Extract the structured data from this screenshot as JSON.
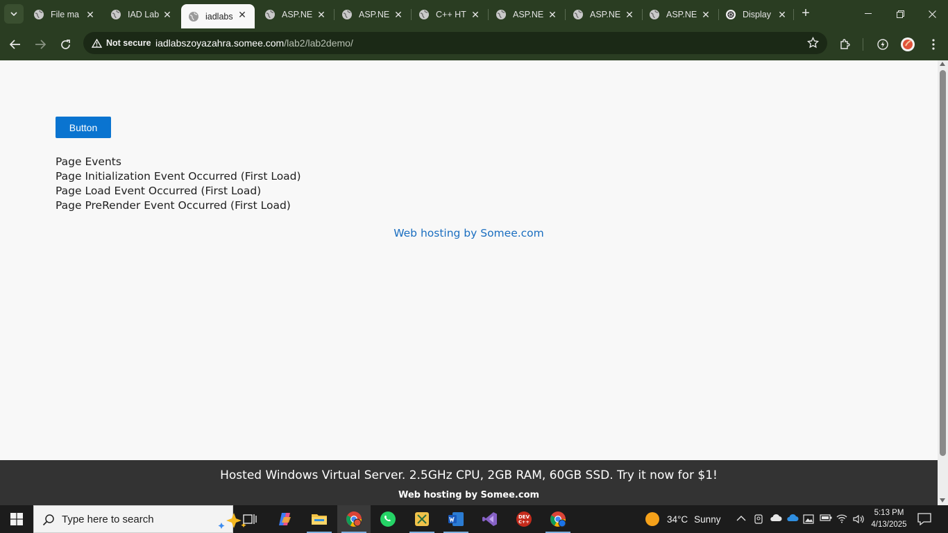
{
  "browser": {
    "tabs": [
      {
        "title": "File ma",
        "active": false,
        "icon": "globe-icon"
      },
      {
        "title": "IAD Lab",
        "active": false,
        "icon": "globe-icon"
      },
      {
        "title": "iadlabs",
        "active": true,
        "icon": "globe-icon"
      },
      {
        "title": "ASP.NE",
        "active": false,
        "icon": "globe-icon"
      },
      {
        "title": "ASP.NE",
        "active": false,
        "icon": "globe-icon"
      },
      {
        "title": "C++ HT",
        "active": false,
        "icon": "globe-icon"
      },
      {
        "title": "ASP.NE",
        "active": false,
        "icon": "globe-icon"
      },
      {
        "title": "ASP.NE",
        "active": false,
        "icon": "globe-icon"
      },
      {
        "title": "ASP.NE",
        "active": false,
        "icon": "globe-icon"
      },
      {
        "title": "Display",
        "active": false,
        "icon": "openai-icon"
      }
    ],
    "security_chip": "Not secure",
    "url_host": "iadlabszoyazahra.somee.com",
    "url_path": "/lab2/lab2demo/"
  },
  "page": {
    "button_label": "Button",
    "events": [
      "Page Events",
      "Page Initialization Event Occurred (First Load)",
      "Page Load Event Occurred (First Load)",
      "Page PreRender Event Occurred (First Load)"
    ],
    "hosting_link": "Web hosting by Somee.com"
  },
  "ad": {
    "main": "Hosted Windows Virtual Server. 2.5GHz CPU, 2GB RAM, 60GB SSD. Try it now for $1!",
    "sub": "Web hosting by Somee.com"
  },
  "taskbar": {
    "search_placeholder": "Type here to search",
    "weather_temp": "34°C",
    "weather_desc": "Sunny",
    "time": "5:13 PM",
    "date": "4/13/2025"
  },
  "colors": {
    "chrome_bg": "#2a3d22",
    "button_blue": "#0a74d0",
    "link_blue": "#1a6ec0",
    "ad_bg": "#333333"
  }
}
